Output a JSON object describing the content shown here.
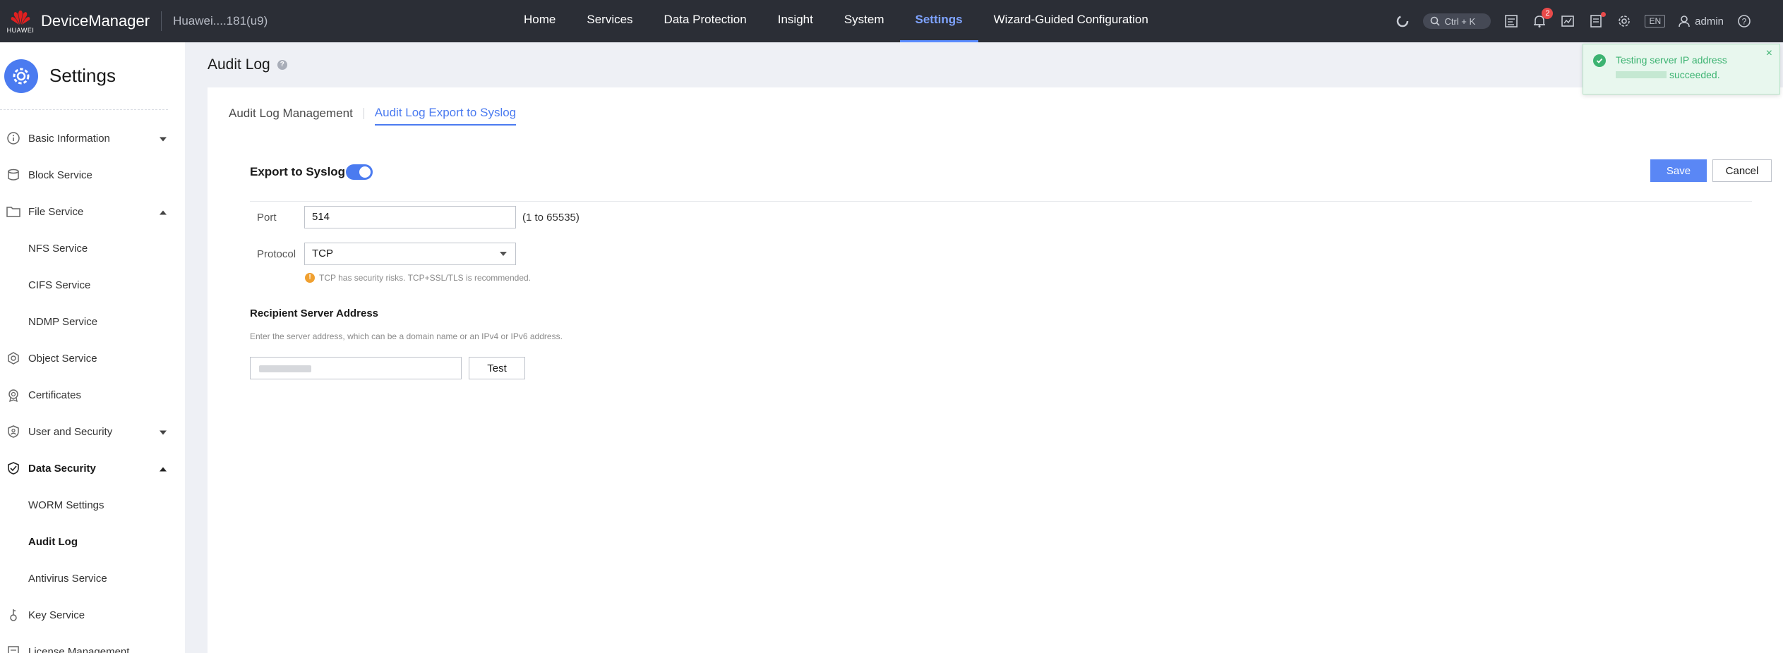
{
  "topbar": {
    "brand_logo_text": "HUAWEI",
    "app_name": "DeviceManager",
    "device_name": "Huawei....181(u9)",
    "nav": [
      {
        "label": "Home"
      },
      {
        "label": "Services"
      },
      {
        "label": "Data Protection"
      },
      {
        "label": "Insight"
      },
      {
        "label": "System"
      },
      {
        "label": "Settings",
        "active": true
      },
      {
        "label": "Wizard-Guided Configuration"
      }
    ],
    "search_shortcut": "Ctrl + K",
    "notification_count": "2",
    "language": "EN",
    "username": "admin"
  },
  "sidebar": {
    "title": "Settings",
    "items": [
      {
        "label": "Basic Information",
        "icon": "info-icon",
        "expandable": "collapsed"
      },
      {
        "label": "Block Service",
        "icon": "block-storage-icon"
      },
      {
        "label": "File Service",
        "icon": "folder-icon",
        "expandable": "expanded"
      },
      {
        "label": "NFS Service",
        "sub": true
      },
      {
        "label": "CIFS Service",
        "sub": true
      },
      {
        "label": "NDMP Service",
        "sub": true
      },
      {
        "label": "Object Service",
        "icon": "object-icon"
      },
      {
        "label": "Certificates",
        "icon": "certificate-icon"
      },
      {
        "label": "User and Security",
        "icon": "user-shield-icon",
        "expandable": "collapsed"
      },
      {
        "label": "Data Security",
        "icon": "shield-icon",
        "expandable": "expanded",
        "bold": true
      },
      {
        "label": "WORM Settings",
        "sub": true
      },
      {
        "label": "Audit Log",
        "sub": true,
        "active": true
      },
      {
        "label": "Antivirus Service",
        "sub": true
      },
      {
        "label": "Key Service",
        "icon": "key-icon"
      },
      {
        "label": "License Management",
        "icon": "license-icon"
      }
    ]
  },
  "page": {
    "title": "Audit Log",
    "tabs": [
      {
        "label": "Audit Log Management"
      },
      {
        "label": "Audit Log Export to Syslog",
        "active": true
      }
    ]
  },
  "form": {
    "export_label": "Export to Syslog",
    "export_enabled": true,
    "save_label": "Save",
    "cancel_label": "Cancel",
    "port_label": "Port",
    "port_value": "514",
    "port_range": "(1 to 65535)",
    "protocol_label": "Protocol",
    "protocol_value": "TCP",
    "protocol_warning": "TCP has security risks. TCP+SSL/TLS is recommended.",
    "recipient_title": "Recipient Server Address",
    "recipient_hint": "Enter the server address, which can be a domain name or an IPv4 or IPv6 address.",
    "test_label": "Test"
  },
  "toast": {
    "line1": "Testing server IP address",
    "line2": "succeeded.",
    "status_color": "#3cb371"
  },
  "colors": {
    "accent": "#4b7bf0",
    "topbar_bg": "#2b2e36",
    "warning": "#f0a030"
  }
}
